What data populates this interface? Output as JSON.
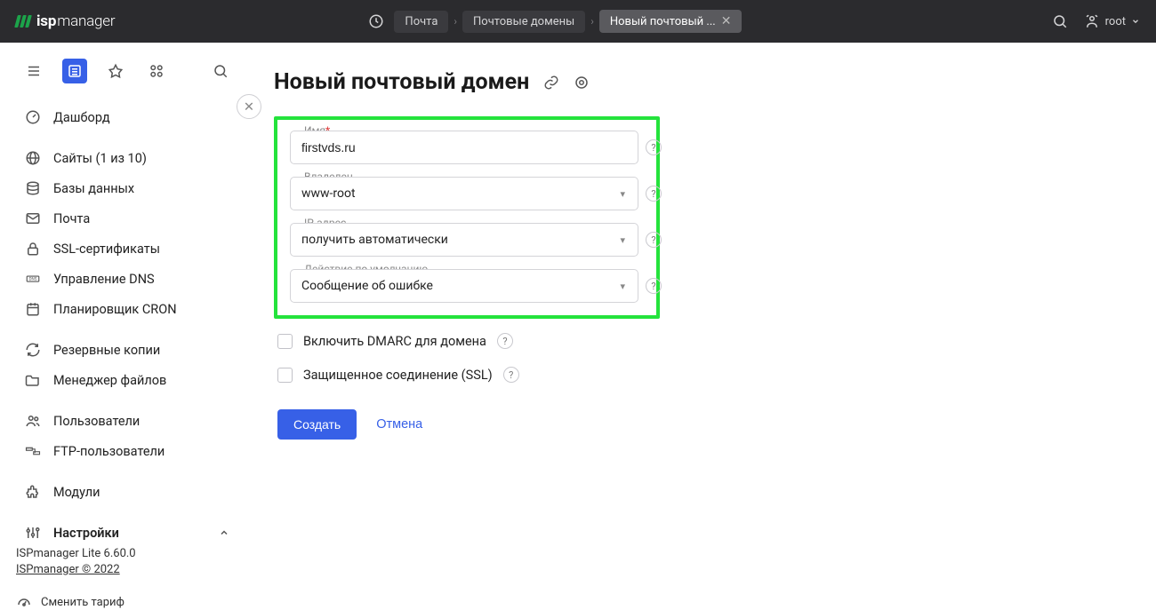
{
  "logo": {
    "bold": "isp",
    "light": "manager"
  },
  "breadcrumbs": {
    "items": [
      {
        "label": "Почта"
      },
      {
        "label": "Почтовые домены"
      },
      {
        "label": "Новый почтовый ...",
        "active": true
      }
    ]
  },
  "topbar": {
    "username": "root"
  },
  "sidebar": {
    "items": [
      {
        "icon": "gauge",
        "label": "Дашборд"
      },
      {
        "sep": true
      },
      {
        "icon": "globe",
        "label": "Сайты (1 из 10)"
      },
      {
        "icon": "db",
        "label": "Базы данных"
      },
      {
        "icon": "mail",
        "label": "Почта"
      },
      {
        "icon": "lock",
        "label": "SSL-сертификаты"
      },
      {
        "icon": "dns",
        "label": "Управление DNS"
      },
      {
        "icon": "cron",
        "label": "Планировщик CRON"
      },
      {
        "sep": true
      },
      {
        "icon": "refresh",
        "label": "Резервные копии"
      },
      {
        "icon": "folder",
        "label": "Менеджер файлов"
      },
      {
        "sep": true
      },
      {
        "icon": "users",
        "label": "Пользователи"
      },
      {
        "icon": "ftp",
        "label": "FTP-пользователи"
      },
      {
        "sep": true
      },
      {
        "icon": "puzzle",
        "label": "Модули"
      },
      {
        "sep": true
      },
      {
        "icon": "sliders",
        "label": "Настройки",
        "caret": true
      }
    ],
    "footer": {
      "version": "ISPmanager Lite 6.60.0",
      "copyright": "ISPmanager © 2022",
      "tariff": "Сменить тариф"
    }
  },
  "page": {
    "title": "Новый почтовый домен",
    "fields": {
      "name": {
        "label": "Имя",
        "value": "firstvds.ru",
        "required": true
      },
      "owner": {
        "label": "Владелец",
        "value": "www-root"
      },
      "ip": {
        "label": "IP-адрес",
        "value": "получить автоматически"
      },
      "default_action": {
        "label": "Действие по умолчанию",
        "value": "Сообщение об ошибке"
      }
    },
    "checkboxes": {
      "dmarc": "Включить DMARC для домена",
      "ssl": "Защищенное соединение (SSL)"
    },
    "actions": {
      "create": "Создать",
      "cancel": "Отмена"
    }
  }
}
